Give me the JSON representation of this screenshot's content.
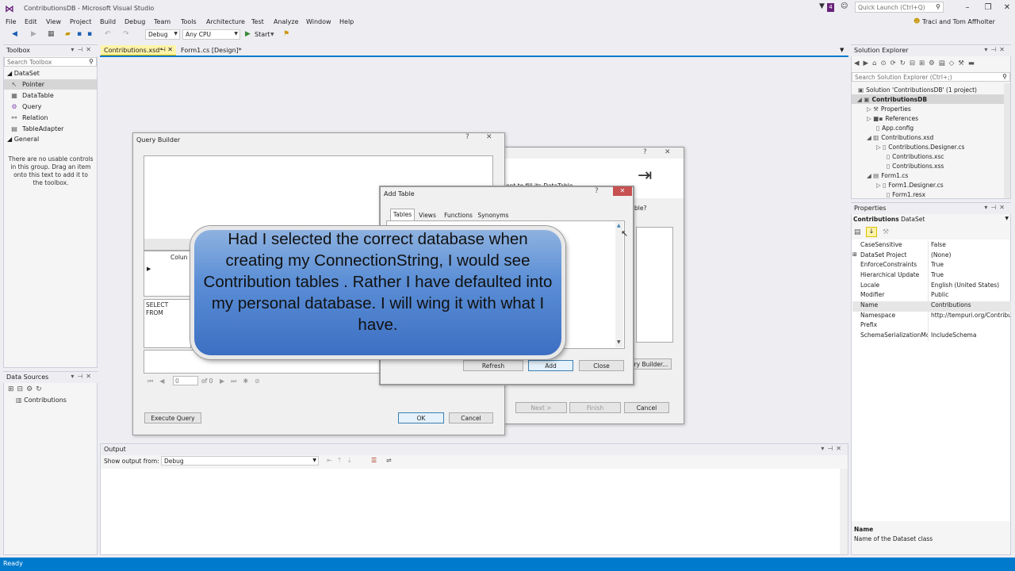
{
  "app": {
    "window_title": "ContributionsDB - Microsoft Visual Studio",
    "quick_launch_placeholder": "Quick Launch (Ctrl+Q)",
    "user_name": "Traci and Tom Affholter",
    "notification_count": "4"
  },
  "menu": [
    "File",
    "Edit",
    "View",
    "Project",
    "Build",
    "Debug",
    "Team",
    "Tools",
    "Architecture",
    "Test",
    "Analyze",
    "Window",
    "Help"
  ],
  "toolbar": {
    "config": "Debug",
    "platform": "Any CPU",
    "start_label": "Start"
  },
  "toolbox": {
    "title": "Toolbox",
    "search_placeholder": "Search Toolbox",
    "group_dataset": "DataSet",
    "items": [
      "Pointer",
      "DataTable",
      "Query",
      "Relation",
      "TableAdapter"
    ],
    "group_general": "General",
    "general_message": "There are no usable controls in this group. Drag an item onto this text to add it to the toolbox."
  },
  "datasources": {
    "title": "Data Sources",
    "item": "Contributions"
  },
  "doc_tabs": [
    "Contributions.xsd*",
    "Form1.cs [Design]*"
  ],
  "output": {
    "title": "Output",
    "show_from_label": "Show output from:",
    "show_from_value": "Debug"
  },
  "solution_explorer": {
    "title": "Solution Explorer",
    "search_placeholder": "Search Solution Explorer (Ctrl+;)",
    "items": [
      {
        "label": "Solution 'ContributionsDB' (1 project)"
      },
      {
        "label": "ContributionsDB"
      },
      {
        "label": "Properties"
      },
      {
        "label": "References"
      },
      {
        "label": "App.config"
      },
      {
        "label": "Contributions.xsd"
      },
      {
        "label": "Contributions.Designer.cs"
      },
      {
        "label": "Contributions.xsc"
      },
      {
        "label": "Contributions.xss"
      },
      {
        "label": "Form1.cs"
      },
      {
        "label": "Form1.Designer.cs"
      },
      {
        "label": "Form1.resx"
      }
    ]
  },
  "properties": {
    "title": "Properties",
    "object_name": "Contributions",
    "object_type": "DataSet",
    "rows": [
      {
        "name": "CaseSensitive",
        "value": "False"
      },
      {
        "name": "DataSet Project",
        "value": "(None)"
      },
      {
        "name": "EnforceConstraints",
        "value": "True"
      },
      {
        "name": "Hierarchical Update",
        "value": "True"
      },
      {
        "name": "Locale",
        "value": "English (United States)"
      },
      {
        "name": "Modifier",
        "value": "Public"
      },
      {
        "name": "Name",
        "value": "Contributions"
      },
      {
        "name": "Namespace",
        "value": "http://tempuri.org/Contribut"
      },
      {
        "name": "Prefix",
        "value": ""
      },
      {
        "name": "SchemaSerializationMode",
        "value": "IncludeSchema"
      }
    ],
    "desc_title": "Name",
    "desc_text": "Name of the Dataset class"
  },
  "wizard": {
    "partial_text_1": "ent to fill its DataTable.",
    "partial_text_2": "ble?",
    "query_builder_button": "ry Builder...",
    "next_button": "Next >",
    "finish_button": "Finish",
    "cancel_button": "Cancel"
  },
  "query_builder": {
    "title": "Query Builder",
    "column_header": "Colun",
    "sql_text_line1": "SELECT",
    "sql_text_line2": "FROM",
    "nav_position": "0",
    "nav_of": "of 0",
    "execute_button": "Execute Query",
    "ok_button": "OK",
    "cancel_button": "Cancel"
  },
  "add_table": {
    "title": "Add Table",
    "tabs": [
      "Tables",
      "Views",
      "Functions",
      "Synonyms"
    ],
    "refresh_button": "Refresh",
    "add_button": "Add",
    "close_button": "Close"
  },
  "callout": {
    "text": "Had I selected the correct database when creating my ConnectionString, I would see Contribution tables .  Rather I have defaulted into my personal database.  I will wing it with what I have."
  },
  "status": {
    "text": "Ready"
  }
}
